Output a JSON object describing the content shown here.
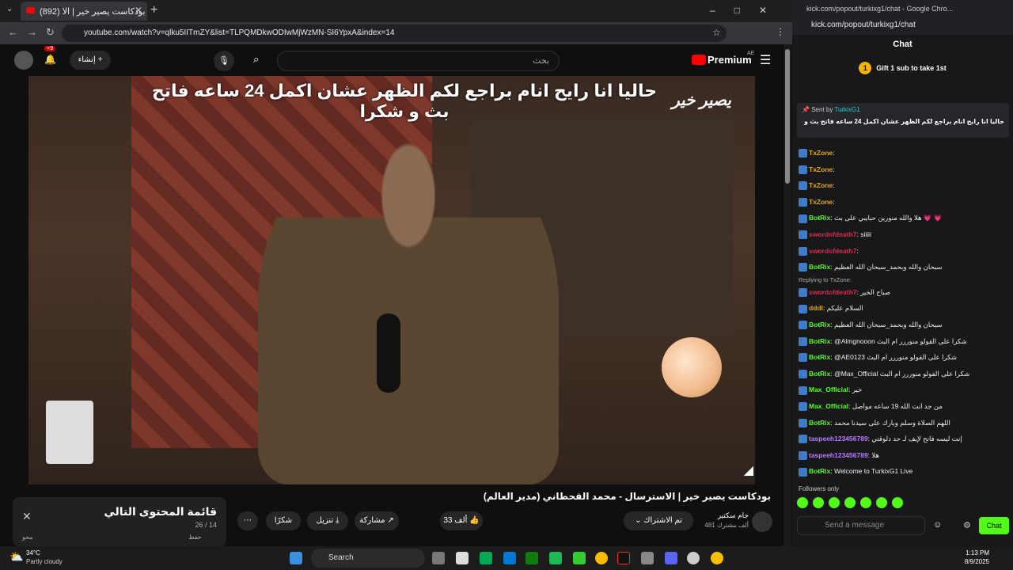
{
  "browser": {
    "tab_title": "(892) بودكاست يصير خير | الا",
    "url": "youtube.com/watch?v=qlku5IITmZY&list=TLPQMDkwODIwMjWzMN-SI6YpxA&index=14"
  },
  "youtube": {
    "brand": "Premium",
    "region": "AE",
    "search_placeholder": "بحث",
    "create_label": "إنشاء",
    "notifications_badge": "+9",
    "caption": "حاليا انا رايح انام براجع لكم الظهر عشان اكمل 24 ساعه فاتح بث و شكرا",
    "video_logo": "يصير خير",
    "video_title": "بودكاست يصير خير | الاسترسال - محمد القحطاني (مدير العالم)",
    "channel_name": "جام سكتير",
    "subscribers": "481 ألف مشترك",
    "subscribed_label": "تم الاشتراك",
    "likes": "33 ألف",
    "share": "مشاركة",
    "download": "تنزيل",
    "thanks": "شكرًا",
    "playlist_title": "قائمة المحتوى التالي",
    "playlist_position": "26 / 14",
    "playlist_owner": "محو",
    "save_label": "حفظ"
  },
  "kick": {
    "window_title": "kick.com/popout/turkixg1/chat - Google Chro...",
    "url": "kick.com/popout/turkixg1/chat",
    "header": "Chat",
    "gift_count": "1",
    "gift_text": "Gift 1 sub to take 1st",
    "pinned_by": "Sent by",
    "pinned_user": "TurkixG1",
    "pinned_text": "حاليا انا رايح انام براجع لكم الظهر عشان اكمل 24 ساعه فاتح بث و شكرا",
    "messages": [
      {
        "user": "TxZone",
        "text": "",
        "color": "#e0a800"
      },
      {
        "user": "TxZone",
        "text": "",
        "color": "#e0a800"
      },
      {
        "user": "TxZone",
        "text": "",
        "color": "#e0a800"
      },
      {
        "user": "TxZone",
        "text": "",
        "color": "#e0a800"
      },
      {
        "user": "BotRix",
        "text": "هلا والله منورين حبايبي على بث 💗 💗",
        "color": "#53fc18"
      },
      {
        "user": "swordofdeath7",
        "text": "siiiii",
        "color": "#e0284a"
      },
      {
        "user": "swordofdeath7",
        "text": "",
        "color": "#e0284a"
      },
      {
        "user": "BotRix",
        "text": "سبحان والله وبحمد_سبحان الله العظيم",
        "color": "#53fc18"
      },
      {
        "user": "swordofdeath7",
        "text": "صباح الخير",
        "color": "#e0284a",
        "reply": "Replying to TxZone:"
      },
      {
        "user": "dddl",
        "text": "السلام عليكم",
        "color": "#e0a800"
      },
      {
        "user": "BotRix",
        "text": "سبحان والله وبحمد_سبحان الله العظيم",
        "color": "#53fc18"
      },
      {
        "user": "BotRix",
        "text": "@Almgnooon شكرا على الفولو منوررر ام البث",
        "color": "#53fc18"
      },
      {
        "user": "BotRix",
        "text": "@AE0123 شكرا على الفولو منوررر ام البث",
        "color": "#53fc18"
      },
      {
        "user": "BotRix",
        "text": "@Max_Official شكرا على الفولو منوررر ام البث",
        "color": "#53fc18"
      },
      {
        "user": "Max_Official",
        "text": "خير",
        "color": "#53fc18"
      },
      {
        "user": "Max_Official",
        "text": "من جد انت الله 19 ساعه مواصل",
        "color": "#53fc18"
      },
      {
        "user": "BotRix",
        "text": "اللهم الصلاة وسلم وبارك على سيدنا محمد",
        "color": "#53fc18"
      },
      {
        "user": "taspeeh123456789",
        "text": "إنت ليسه فاتح لإيف لـ حد دلوقتي",
        "color": "#b77bff"
      },
      {
        "user": "taspeeh123456789",
        "text": "هلا",
        "color": "#b77bff"
      },
      {
        "user": "BotRix",
        "text": "Welcome to TurkixG1 Live",
        "color": "#53fc18"
      }
    ],
    "followers_only": "Followers only",
    "input_placeholder": "Send a message",
    "chat_button": "Chat"
  },
  "taskbar": {
    "temperature": "34°C",
    "weather": "Partly cloudy",
    "search_label": "Search",
    "time": "1:13 PM",
    "date": "8/9/2025"
  }
}
